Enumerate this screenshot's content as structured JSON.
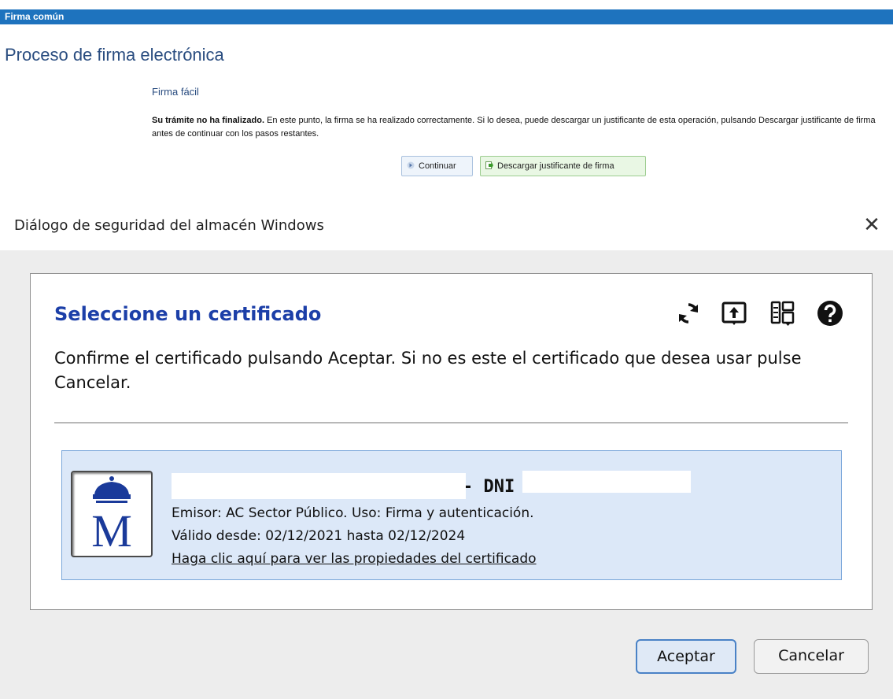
{
  "web": {
    "header": "Firma común",
    "title": "Proceso de firma electrónica",
    "subtitle": "Firma fácil",
    "notice_bold": "Su trámite no ha finalizado.",
    "notice_text": " En este punto, la firma se ha realizado correctamente. Si lo desea, puede descargar un justificante de esta operación, pulsando Descargar justificante de firma antes de continuar con los pasos restantes.",
    "continue_label": "Continuar",
    "download_label": "Descargar justificante de firma"
  },
  "dialog": {
    "title": "Diálogo de seguridad del almacén Windows",
    "close_glyph": "✕",
    "heading": "Seleccione un certificado",
    "instruction": "Confirme el certificado pulsando Aceptar. Si no es este el certificado que desea usar pulse Cancelar.",
    "toolbar_icons": [
      "refresh-icon",
      "open-certificate-icon",
      "show-all-certificates-icon",
      "help-icon"
    ],
    "certificate": {
      "name_visible": "- DNI",
      "issuer": "Emisor: AC Sector Público. Uso: Firma y autenticación.",
      "validity": "Válido desde: 02/12/2021 hasta 02/12/2024",
      "link": "Haga clic aquí para ver las propiedades del certificado"
    },
    "accept_label": "Aceptar",
    "cancel_label": "Cancelar"
  },
  "colors": {
    "header_blue": "#1e73be",
    "heading_blue": "#1c3fa8",
    "cert_bg": "#dce8f8",
    "dialog_bg": "#ededed"
  }
}
